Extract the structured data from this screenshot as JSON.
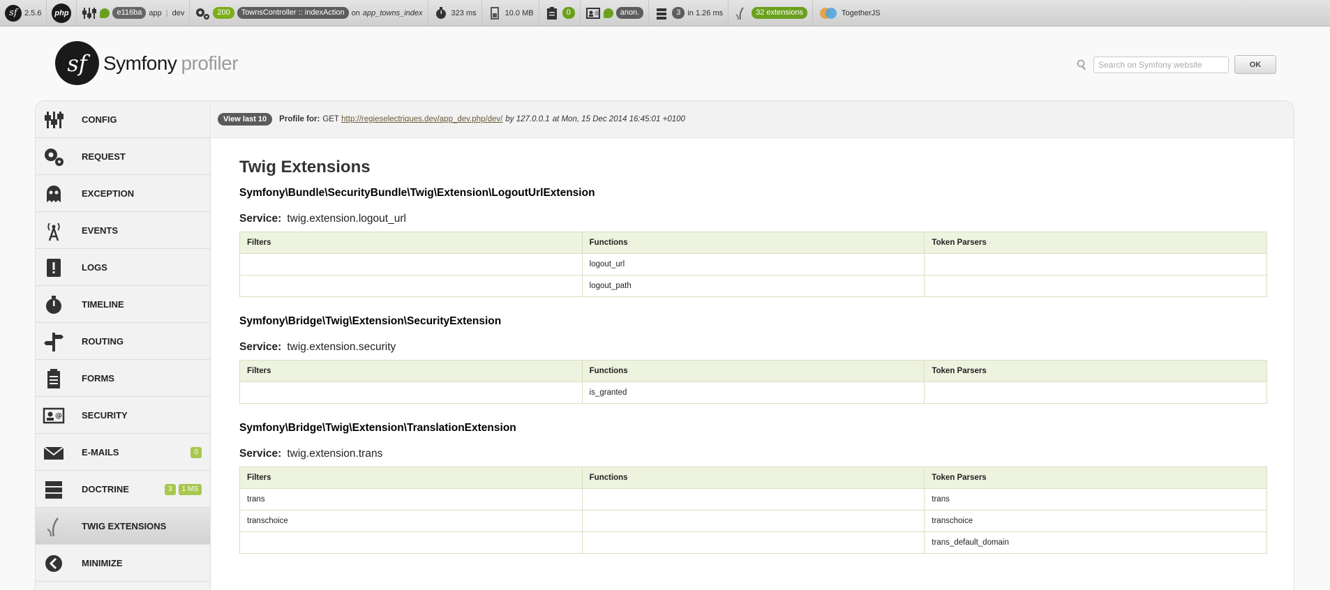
{
  "toolbar": {
    "version": "2.5.6",
    "token": "e116ba",
    "app_name": "app",
    "env": "dev",
    "status_code": "200",
    "controller": "TownsController :: indexAction",
    "route_prefix": "on",
    "route": "app_towns_index",
    "time": "323 ms",
    "memory": "10.0 MB",
    "forms_count": "0",
    "user": "anon.",
    "db_queries": "3",
    "db_time": "in 1.26 ms",
    "twig_extensions": "32 extensions",
    "togetherjs": "TogetherJS"
  },
  "header": {
    "brand_word": "Symfony",
    "brand_sub": "profiler",
    "search_placeholder": "Search on Symfony website",
    "search_button": "OK"
  },
  "sidebar": {
    "items": [
      {
        "label": "CONFIG"
      },
      {
        "label": "REQUEST"
      },
      {
        "label": "EXCEPTION"
      },
      {
        "label": "EVENTS"
      },
      {
        "label": "LOGS"
      },
      {
        "label": "TIMELINE"
      },
      {
        "label": "ROUTING"
      },
      {
        "label": "FORMS"
      },
      {
        "label": "SECURITY"
      },
      {
        "label": "E-MAILS",
        "badge": "0"
      },
      {
        "label": "DOCTRINE",
        "badge": "3",
        "badge2": "1 MS"
      },
      {
        "label": "TWIG EXTENSIONS"
      },
      {
        "label": "MINIMIZE"
      }
    ]
  },
  "resume": {
    "view_last": "View last 10",
    "profile_label": "Profile for:",
    "method": "GET",
    "url": "http://regieselectriques.dev/app_dev.php/dev/",
    "by": "by 127.0.0.1",
    "at": "at Mon, 15 Dec 2014 16:45:01 +0100"
  },
  "panel": {
    "title": "Twig Extensions",
    "service_label": "Service:",
    "columns": [
      "Filters",
      "Functions",
      "Token Parsers"
    ],
    "extensions": [
      {
        "name": "Symfony\\Bundle\\SecurityBundle\\Twig\\Extension\\LogoutUrlExtension",
        "service": "twig.extension.logout_url",
        "rows": [
          [
            "",
            "logout_url",
            ""
          ],
          [
            "",
            "logout_path",
            ""
          ]
        ]
      },
      {
        "name": "Symfony\\Bridge\\Twig\\Extension\\SecurityExtension",
        "service": "twig.extension.security",
        "rows": [
          [
            "",
            "is_granted",
            ""
          ]
        ]
      },
      {
        "name": "Symfony\\Bridge\\Twig\\Extension\\TranslationExtension",
        "service": "twig.extension.trans",
        "rows": [
          [
            "trans",
            "",
            "trans"
          ],
          [
            "transchoice",
            "",
            "transchoice"
          ],
          [
            "",
            "",
            "trans_default_domain"
          ]
        ]
      }
    ]
  }
}
